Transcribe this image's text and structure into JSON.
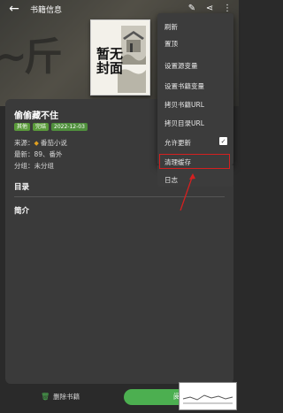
{
  "header": {
    "title": "书籍信息"
  },
  "cover": {
    "text": "暂无封面"
  },
  "book": {
    "title": "偷偷藏不住",
    "tags": [
      "其他",
      "完结",
      "2022-12-03"
    ],
    "source_label": "来源：",
    "source_value": "番茄小说",
    "latest_label": "最新：",
    "latest_value": "89、番外",
    "group_label": "分组：",
    "group_value": "未分组"
  },
  "sections": {
    "toc": "目录",
    "intro": "简介"
  },
  "menu": {
    "items": [
      "刷新",
      "置顶",
      "设置源变量",
      "设置书籍变量",
      "拷贝书籍URL",
      "拷贝目录URL",
      "允许更新",
      "清理缓存",
      "日志"
    ],
    "allow_update_checked": true,
    "highlighted_item": "清理缓存"
  },
  "bottom": {
    "delete_label": "删除书籍",
    "read_label": "阅"
  },
  "colors": {
    "accent": "#4caf50",
    "highlight": "#d42020"
  }
}
